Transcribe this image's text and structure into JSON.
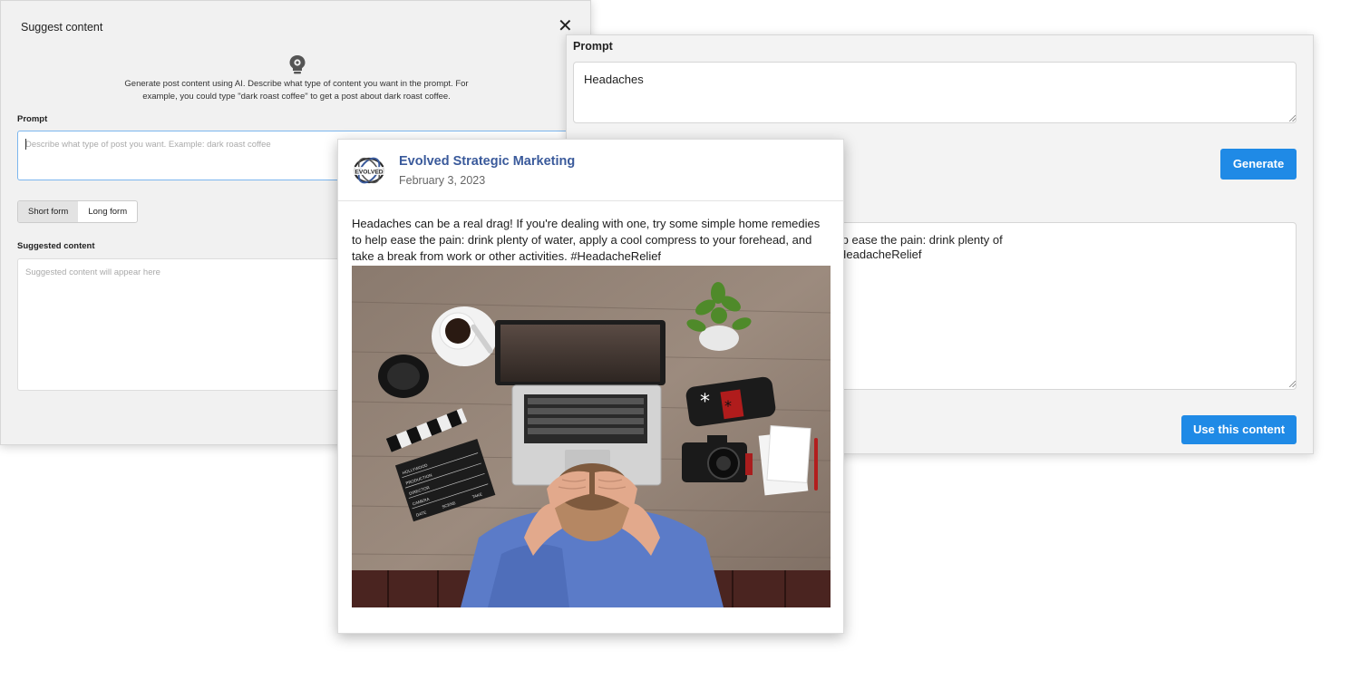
{
  "left_modal": {
    "title": "Suggest content",
    "close_glyph": "✕",
    "icon": "lightbulb-gear-icon",
    "intro_line1": "Generate post content using AI. Describe what type of content you want in the prompt. For",
    "intro_line2": "example, you could type \"dark roast coffee\" to get a post about dark roast coffee.",
    "prompt_label": "Prompt",
    "prompt_placeholder": "Describe what type of post you want. Example: dark roast coffee",
    "form_options": [
      "Short form",
      "Long form"
    ],
    "selected_form": "Short form",
    "suggested_label": "Suggested content",
    "suggested_placeholder": "Suggested content will appear here"
  },
  "right_modal": {
    "prompt_label": "Prompt",
    "prompt_value": "Headaches",
    "generate_button": "Generate",
    "suggested_text_line1": "Headaches can be a real drag! If you're dealing with one, try some simple home remedies to help ease the pain: drink plenty of",
    "suggested_text_line2": "water, apply a cool compress to your forehead, and take a break from work or other activities. #HeadacheRelief",
    "use_button": "Use this content"
  },
  "post": {
    "brand_name": "Evolved Strategic Marketing",
    "logo_text": "EVOLVED",
    "date": "February 3, 2023",
    "body": "Headaches can be a real drag! If you're dealing with one, try some simple home remedies to help ease the pain: drink plenty of water, apply a cool compress to your forehead, and take a break from work or other activities. #HeadacheRelief",
    "image_alt": "person holding head at desk with laptop",
    "clapper_text": [
      "HOLLYWOOD",
      "PRODUCTION",
      "DIRECTOR",
      "CAMERA",
      "DATE",
      "SCENE",
      "TAKE"
    ]
  },
  "colors": {
    "accent": "#1f8ae6",
    "brand": "#3a5a9b",
    "focus_border": "#7cb6ee"
  }
}
